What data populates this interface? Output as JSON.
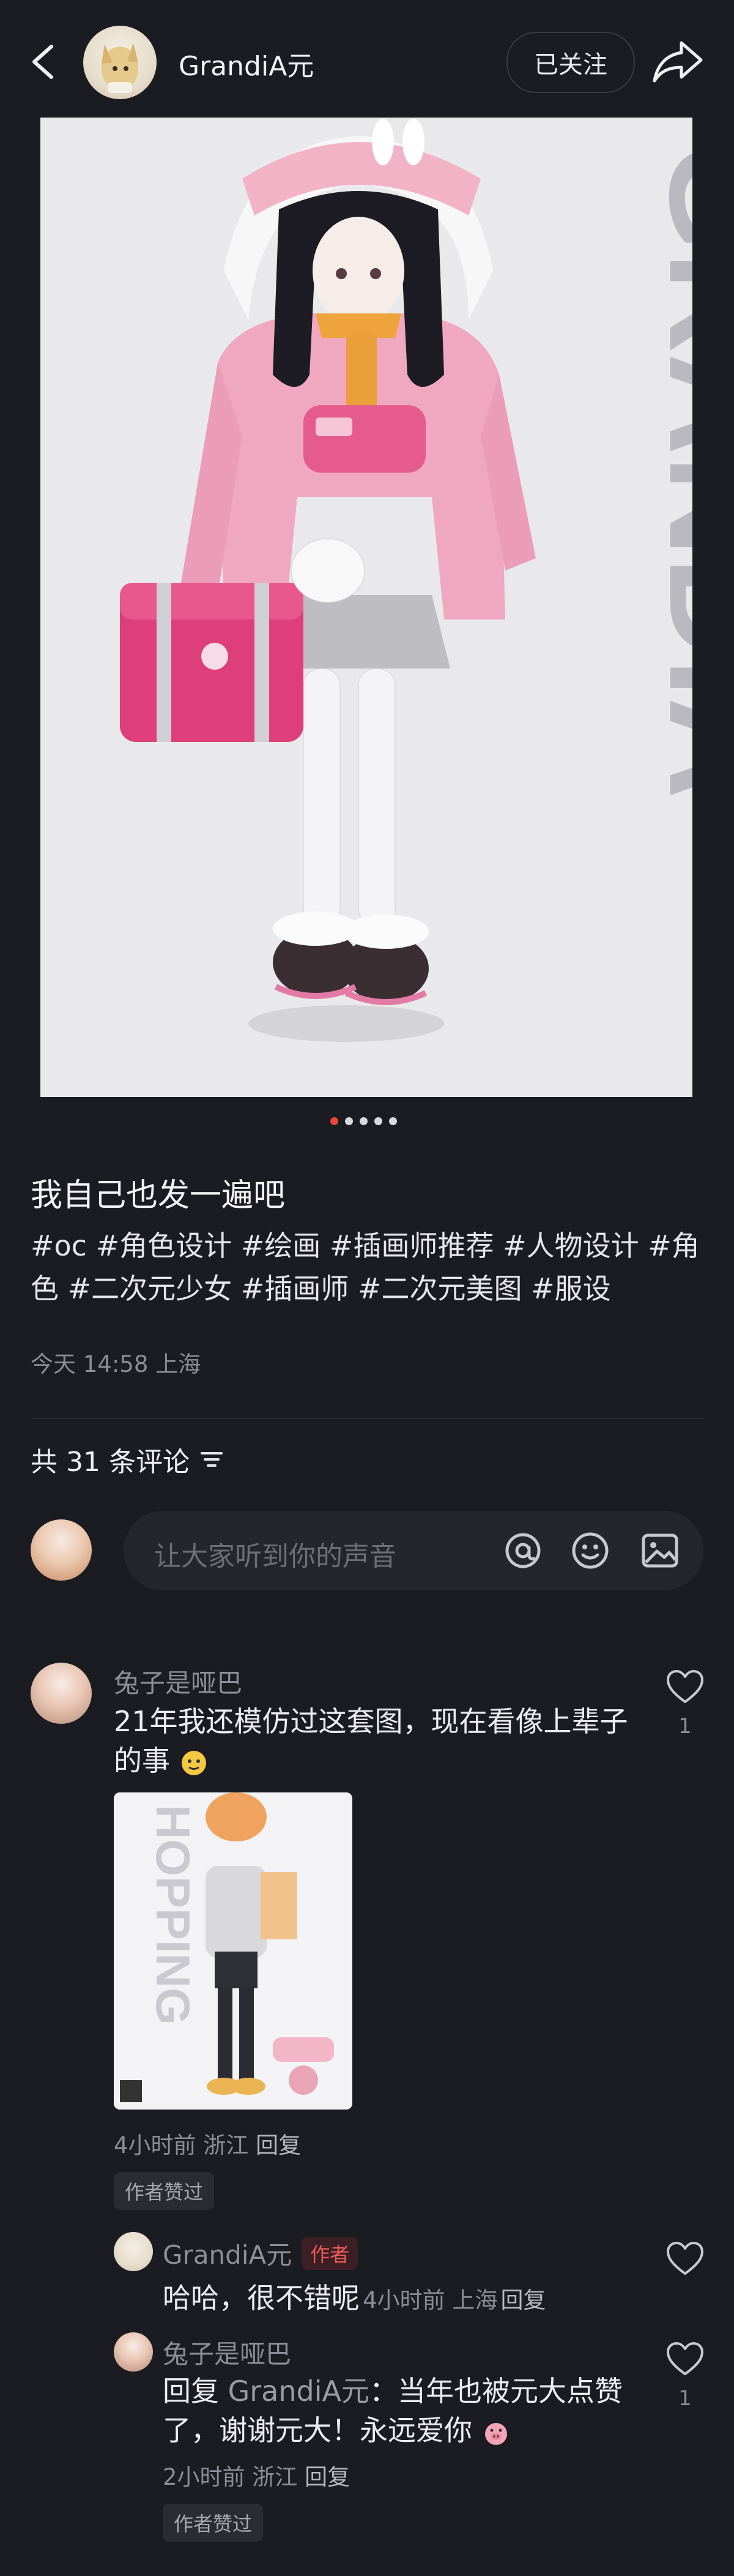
{
  "header": {
    "author_name": "GrandiA元",
    "follow_label": "已关注"
  },
  "artwork": {
    "watermark_text": "GRANDIA",
    "page_indicator": {
      "count": 5,
      "active_index": 0
    }
  },
  "post": {
    "title": "我自己也发一遍吧",
    "hashtags": "#oc #角色设计 #绘画 #插画师推荐 #人物设计 #角色 #二次元少女 #插画师 #二次元美图 #服设",
    "meta": "今天 14:58 上海"
  },
  "comments_section": {
    "count_label": "共 31 条评论",
    "input_placeholder": "让大家听到你的声音"
  },
  "comments": {
    "c1": {
      "user": "兔子是哑巴",
      "text": "21年我还模仿过这套图，现在看像上辈子的事",
      "thumb_text": "HOPPING",
      "meta_time_loc": "4小时前 浙江",
      "reply_label": "回复",
      "badge": "作者赞过",
      "like_count": "1"
    },
    "r1": {
      "user": "GrandiA元",
      "author_tag": "作者",
      "text": "哈哈，很不错呢",
      "meta_time_loc": "4小时前 上海",
      "reply_label": "回复"
    },
    "r2": {
      "user": "兔子是哑巴",
      "reply_prefix": "回复",
      "mention": "GrandiA元",
      "text": "：当年也被元大点赞了，谢谢元大！永远爱你",
      "meta_time_loc": "2小时前 浙江",
      "reply_label": "回复",
      "badge": "作者赞过",
      "like_count": "1"
    }
  }
}
